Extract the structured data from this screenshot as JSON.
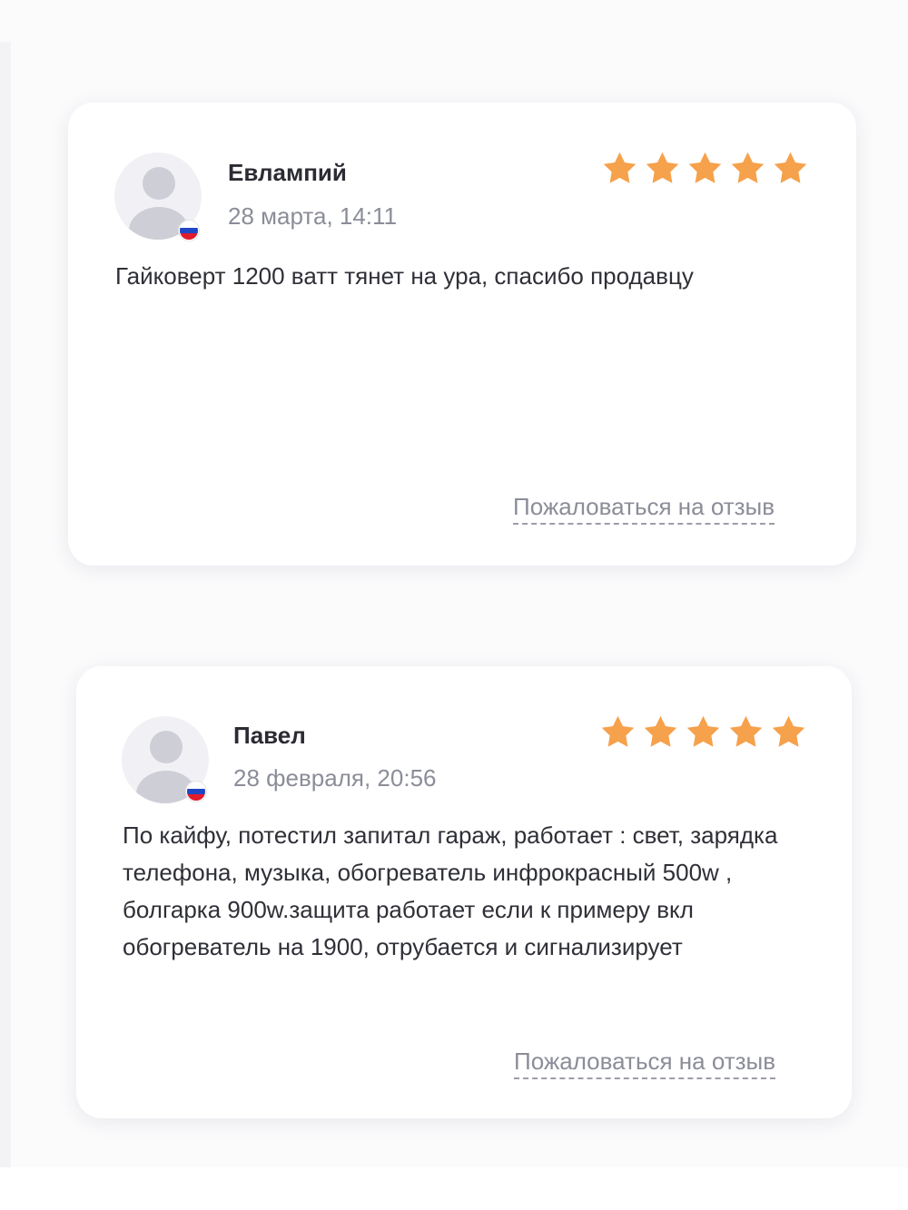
{
  "colors": {
    "star": "#f6a14b",
    "text_primary": "#2b2b33",
    "text_secondary": "#8b8d98",
    "card_background": "#ffffff",
    "page_background": "#fbfbfc"
  },
  "reviews": [
    {
      "author": "Евлампий",
      "date": "28 марта, 14:11",
      "rating": 5,
      "rating_max": 5,
      "country_flag": "russia-flag-icon",
      "text": "Гайковерт 1200 ватт тянет на ура, спасибо продавцу",
      "report_label": "Пожаловаться на отзыв"
    },
    {
      "author": "Павел",
      "date": "28 февраля, 20:56",
      "rating": 5,
      "rating_max": 5,
      "country_flag": "russia-flag-icon",
      "text": "По кайфу, потестил запитал гараж, работает : свет, зарядка телефона, музыка, обогреватель инфрокрасный 500w , болгарка 900w.защита работает если к примеру вкл обогреватель на 1900, отрубается и сигнализирует",
      "report_label": "Пожаловаться на отзыв"
    }
  ]
}
